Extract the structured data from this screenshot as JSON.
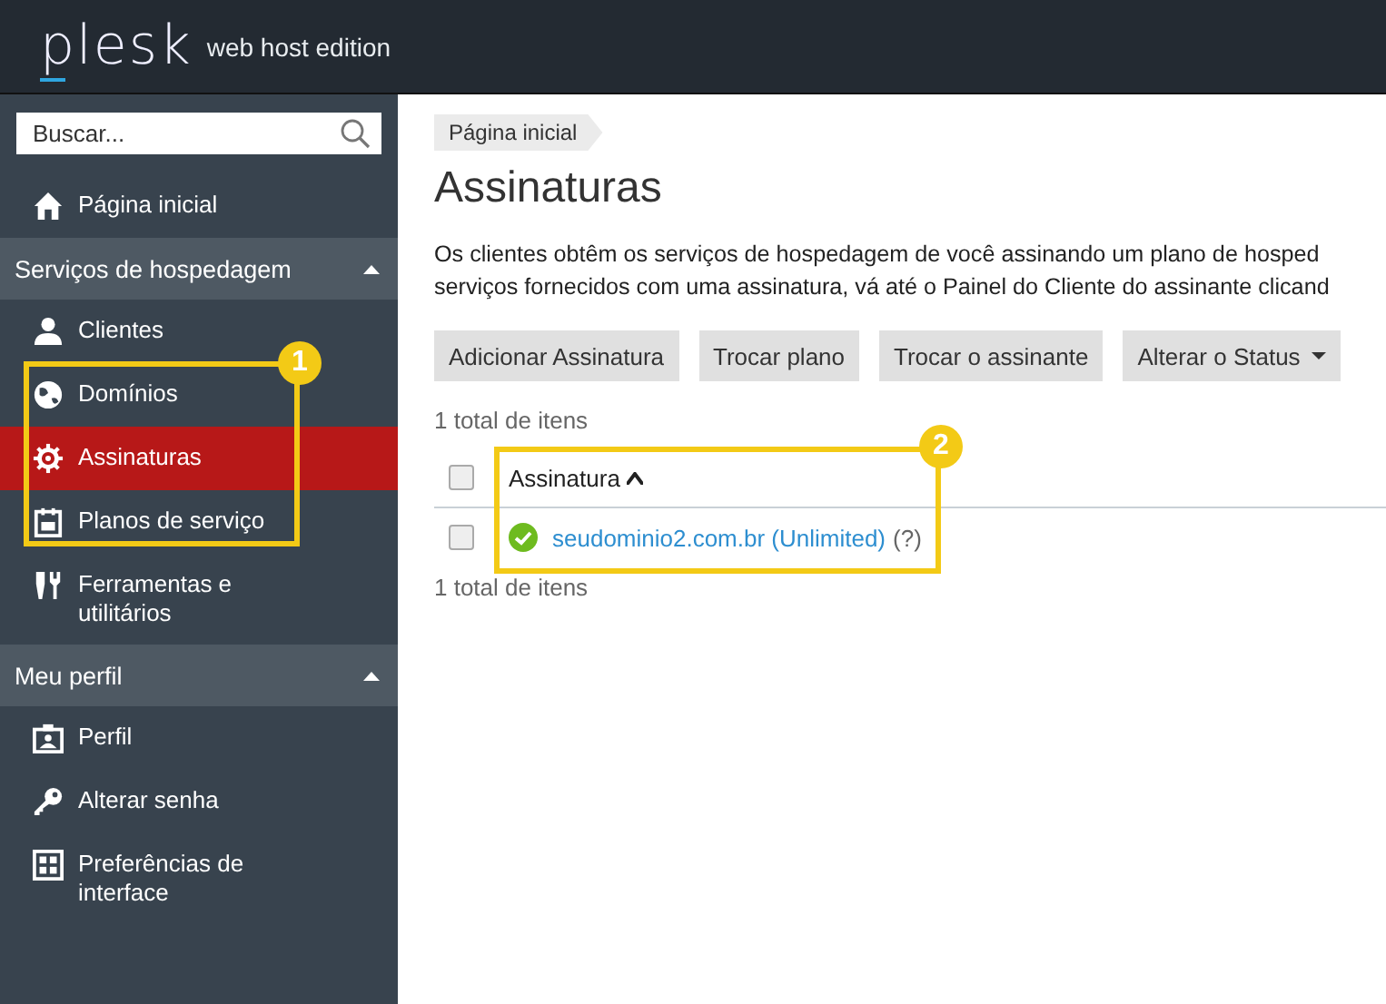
{
  "header": {
    "logo": "plesk",
    "edition": "web host edition"
  },
  "sidebar": {
    "search": {
      "placeholder": "Buscar..."
    },
    "items": [
      {
        "label": "Página inicial",
        "selected": false
      }
    ],
    "sections": [
      {
        "title": "Serviços de hospedagem",
        "expanded": true,
        "items": [
          {
            "label": "Clientes",
            "selected": false
          },
          {
            "label": "Domínios",
            "selected": false
          },
          {
            "label": "Assinaturas",
            "selected": true
          },
          {
            "label": "Planos de serviço",
            "selected": false
          },
          {
            "label": "Ferramentas e utilitários",
            "selected": false
          }
        ]
      },
      {
        "title": "Meu perfil",
        "expanded": true,
        "items": [
          {
            "label": "Perfil",
            "selected": false
          },
          {
            "label": "Alterar senha",
            "selected": false
          },
          {
            "label": "Preferências de interface",
            "selected": false
          }
        ]
      }
    ]
  },
  "breadcrumb": "Página inicial",
  "title": "Assinaturas",
  "description": [
    "Os clientes obtêm os serviços de hospedagem de você assinando um plano de hosped",
    "serviços fornecidos com uma assinatura, vá até o Painel do Cliente do assinante clicand"
  ],
  "toolbar": [
    {
      "label": "Adicionar Assinatura",
      "dropdown": false
    },
    {
      "label": "Trocar plano",
      "dropdown": false
    },
    {
      "label": "Trocar o assinante",
      "dropdown": false
    },
    {
      "label": "Alterar o Status",
      "dropdown": true
    }
  ],
  "table": {
    "count_top": "1 total de itens",
    "column": "Assinatura",
    "rows": [
      {
        "name": "seudominio2.com.br (Unlimited)",
        "help": "(?)",
        "checked": false
      }
    ],
    "header_checked": false,
    "count_bottom": "1 total de itens"
  },
  "annotations": [
    {
      "number": "1"
    },
    {
      "number": "2"
    }
  ]
}
